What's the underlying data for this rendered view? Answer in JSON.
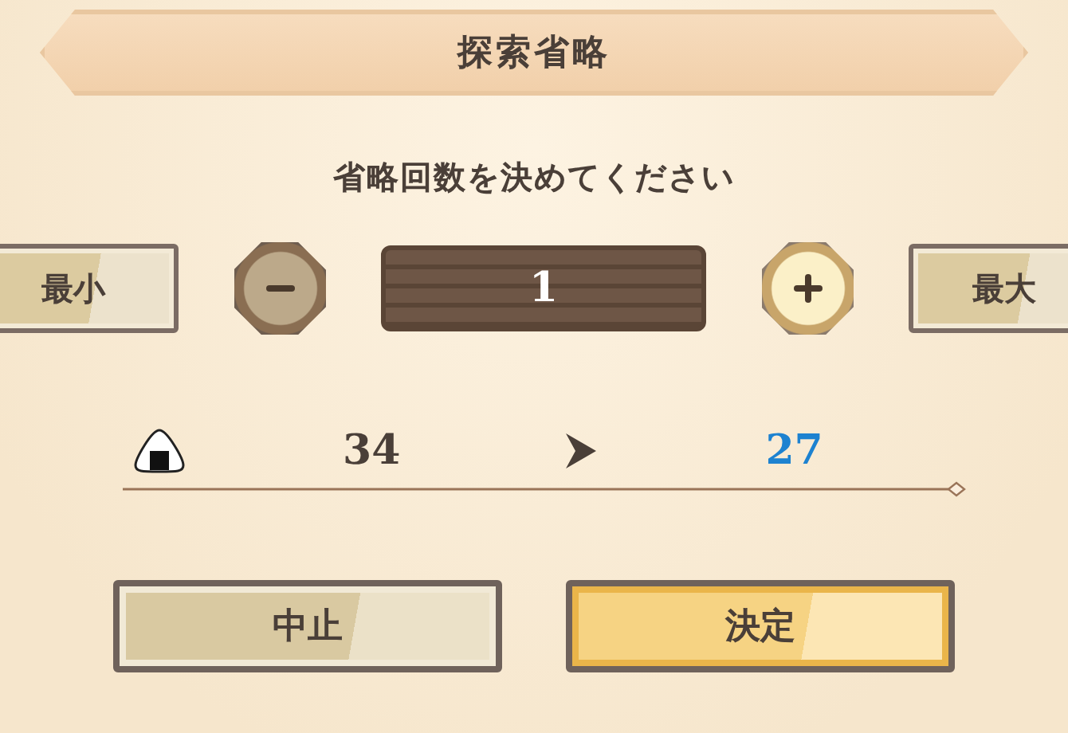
{
  "title": "探索省略",
  "prompt": "省略回数を決めてください",
  "stepper": {
    "min_label": "最小",
    "max_label": "最大",
    "value": "1",
    "decrease": {
      "disabled": true
    },
    "increase": {
      "disabled": false
    }
  },
  "exchange": {
    "current": "34",
    "result": "27"
  },
  "buttons": [
    {
      "label": "中止",
      "kind": "cancel"
    },
    {
      "label": "決定",
      "kind": "confirm"
    }
  ]
}
